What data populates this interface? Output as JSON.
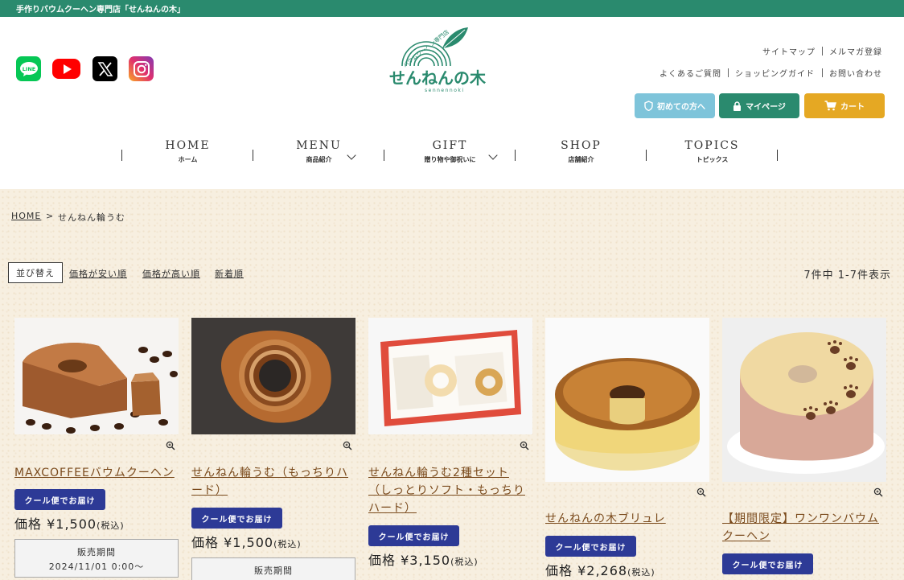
{
  "topbar": {
    "text": "手作りバウムクーヘン専門店「せんねんの木」"
  },
  "social": [
    {
      "name": "line-icon",
      "label": "LINE"
    },
    {
      "name": "youtube-icon",
      "label": ""
    },
    {
      "name": "x-icon",
      "label": ""
    },
    {
      "name": "instagram-icon",
      "label": ""
    }
  ],
  "logo": {
    "top_text": "バウムクーヘン専門店",
    "main_text": "せんねんの木",
    "roman": "sennennoki"
  },
  "utility": {
    "sitemap": "サイトマップ",
    "mailmag": "メルマガ登録",
    "faq": "よくあるご質問",
    "guide": "ショッピングガイド",
    "contact": "お問い合わせ"
  },
  "header_buttons": {
    "first": "初めての方へ",
    "mypage": "マイページ",
    "cart": "カート"
  },
  "nav": [
    {
      "en": "HOME",
      "jp": "ホーム"
    },
    {
      "en": "MENU",
      "jp": "商品紹介"
    },
    {
      "en": "GIFT",
      "jp": "贈り物や御祝いに"
    },
    {
      "en": "SHOP",
      "jp": "店舗紹介"
    },
    {
      "en": "TOPICS",
      "jp": "トピックス"
    }
  ],
  "breadcrumb": {
    "home": "HOME",
    "sep": ">",
    "current": "せんねん輪うむ"
  },
  "sort": {
    "label": "並び替え",
    "options": [
      "価格が安い順",
      "価格が高い順",
      "新着順"
    ]
  },
  "count": "7件中 1-7件表示",
  "products": [
    {
      "name": "MAXCOFFEEバウムクーヘン",
      "badge": "クール便でお届け",
      "price_prefix": "価格 ",
      "price": "¥1,500",
      "tax": "(税込)",
      "sale_title": "販売期間",
      "sale_date": "2024/11/01 0:00〜"
    },
    {
      "name": "せんねん輪うむ（もっちりハード）",
      "badge": "クール便でお届け",
      "price_prefix": "価格 ",
      "price": "¥1,500",
      "tax": "(税込)",
      "sale_title": "販売期間",
      "sale_date": ""
    },
    {
      "name": "せんねん輪うむ2種セット（しっとりソフト・もっちりハード）",
      "badge": "クール便でお届け",
      "price_prefix": "価格 ",
      "price": "¥3,150",
      "tax": "(税込)"
    },
    {
      "name": "せんねんの木ブリュレ",
      "badge": "クール便でお届け",
      "price_prefix": "価格 ",
      "price": "¥2,268",
      "tax": "(税込)"
    },
    {
      "name": "【期間限定】ワンワンバウムクーヘン",
      "badge": "クール便でお届け"
    }
  ],
  "colors": {
    "brand_green": "#2a8a6e",
    "badge_blue": "#2d3a96",
    "cart_gold": "#e5a823",
    "first_blue": "#7ec4da",
    "link_brown": "#7a4a1c"
  }
}
